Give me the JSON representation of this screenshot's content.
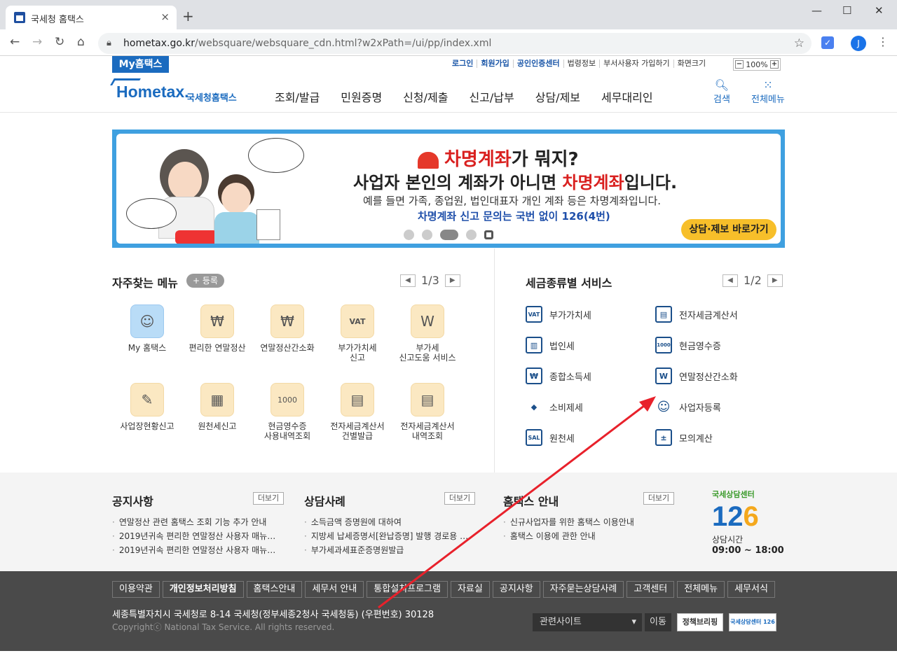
{
  "browser": {
    "tab_title": "국세청 홈택스",
    "tab_close": "×",
    "new_tab": "+",
    "win_min": "—",
    "win_max": "☐",
    "win_close": "✕",
    "url_host": "hometax.go.kr",
    "url_path": "/websquare/websquare_cdn.html?w2xPath=/ui/pp/index.xml",
    "profile_initial": "J"
  },
  "util": {
    "my_hometax": "My홈택스",
    "links": [
      "로그인",
      "회원가입",
      "공인인증센터",
      "법령정보",
      "부서사용자 가입하기",
      "화면크기"
    ],
    "zoom_minus": "−",
    "zoom_value": "100%",
    "zoom_plus": "+"
  },
  "logo": {
    "main": "Hometax.",
    "sub": "국세청홈택스"
  },
  "gnb": [
    "조회/발급",
    "민원증명",
    "신청/제출",
    "신고/납부",
    "상담/제보",
    "세무대리인"
  ],
  "top_icons": {
    "search": "검색",
    "all_menu": "전체메뉴"
  },
  "banner": {
    "line1_red": "차명계좌",
    "line1_rest": "가 뭐지?",
    "line2_a": "사업자 본인의 계좌가 아니면 ",
    "line2_red": "차명계좌",
    "line2_b": "입니다.",
    "line3": "예를 들면 가족, 종업원, 법인대표자 개인 계좌 등은 차명계좌입니다.",
    "line4": "차명계좌 신고 문의는 국번 없이 126(4번)",
    "button": "상담·제보 바로가기"
  },
  "favorites": {
    "title": "자주찾는 메뉴",
    "register": "+ 등록",
    "page": "1/3",
    "items": [
      {
        "label": "My 홈택스",
        "icon": "person-icon"
      },
      {
        "label": "편리한 연말정산",
        "icon": "calculator-icon"
      },
      {
        "label": "연말정산간소화",
        "icon": "money-bag-icon"
      },
      {
        "label": "부가가치세\n신고",
        "icon": "vat-doc-icon"
      },
      {
        "label": "부가세\n신고도움 서비스",
        "icon": "search-doc-icon"
      },
      {
        "label": "사업장현황신고",
        "icon": "edit-doc-icon"
      },
      {
        "label": "원천세신고",
        "icon": "calendar-icon"
      },
      {
        "label": "현금영수증\n사용내역조회",
        "icon": "receipt-icon"
      },
      {
        "label": "전자세금계산서\n건별발급",
        "icon": "invoice-icon"
      },
      {
        "label": "전자세금계산서\n내역조회",
        "icon": "invoice-search-icon"
      }
    ]
  },
  "tax_services": {
    "title": "세금종류별 서비스",
    "page": "1/2",
    "items": [
      {
        "label": "부가가치세",
        "icon": "vat-icon",
        "glyph": "VAT"
      },
      {
        "label": "전자세금계산서",
        "icon": "invoice-icon",
        "glyph": "▤"
      },
      {
        "label": "법인세",
        "icon": "building-icon",
        "glyph": "▥"
      },
      {
        "label": "현금영수증",
        "icon": "receipt-icon",
        "glyph": "1000"
      },
      {
        "label": "종합소득세",
        "icon": "money-bag-icon",
        "glyph": "₩"
      },
      {
        "label": "연말정산간소화",
        "icon": "calculator-icon",
        "glyph": "W"
      },
      {
        "label": "소비제세",
        "icon": "diamond-icon",
        "glyph": "◆"
      },
      {
        "label": "사업자등록",
        "icon": "person-icon",
        "glyph": "☺"
      },
      {
        "label": "원천세",
        "icon": "sal-doc-icon",
        "glyph": "SAL"
      },
      {
        "label": "모의계산",
        "icon": "calc-icon",
        "glyph": "±"
      }
    ]
  },
  "info": {
    "notice": {
      "title": "공지사항",
      "more": "더보기",
      "items": [
        "연말정산 관련 홈택스 조회 기능 추가 안내",
        "2019년귀속 편리한 연말정산 사용자 매뉴…",
        "2019년귀속 편리한 연말정산 사용자 매뉴…"
      ]
    },
    "cases": {
      "title": "상담사례",
      "more": "더보기",
      "items": [
        "소득금액 증명원에 대하여",
        "지방세 납세증명서[완납증명] 발행 경로용 …",
        "부가세과세표준증명원발급"
      ]
    },
    "guide": {
      "title": "홈택스 안내",
      "more": "더보기",
      "items": [
        "신규사업자를 위한 홈택스 이용안내",
        "홈택스 이용에 관한 안내"
      ]
    },
    "center": {
      "caption": "국세상담센터",
      "num_a": "12",
      "num_b": "6",
      "hours_label": "상담시간",
      "hours": "09:00 ~ 18:00"
    }
  },
  "footer": {
    "links": [
      "이용약관",
      "개인정보처리방침",
      "홈택스안내",
      "세무서 안내",
      "통합설치프로그램",
      "자료실",
      "공지사항",
      "자주묻는상담사례",
      "고객센터",
      "전체메뉴",
      "세무서식"
    ],
    "address": "세종특별자치시 국세청로 8-14 국세청(정부세종2청사 국세청동) (우편번호) 30128",
    "copyright": "Copyrightⓒ National Tax Service. All rights reserved.",
    "related_site": "관련사이트",
    "go": "이동",
    "badge1": "정책브리핑",
    "badge2": "국세상담센터 126"
  },
  "annotation": {
    "arrow_color": "#e8212b"
  }
}
